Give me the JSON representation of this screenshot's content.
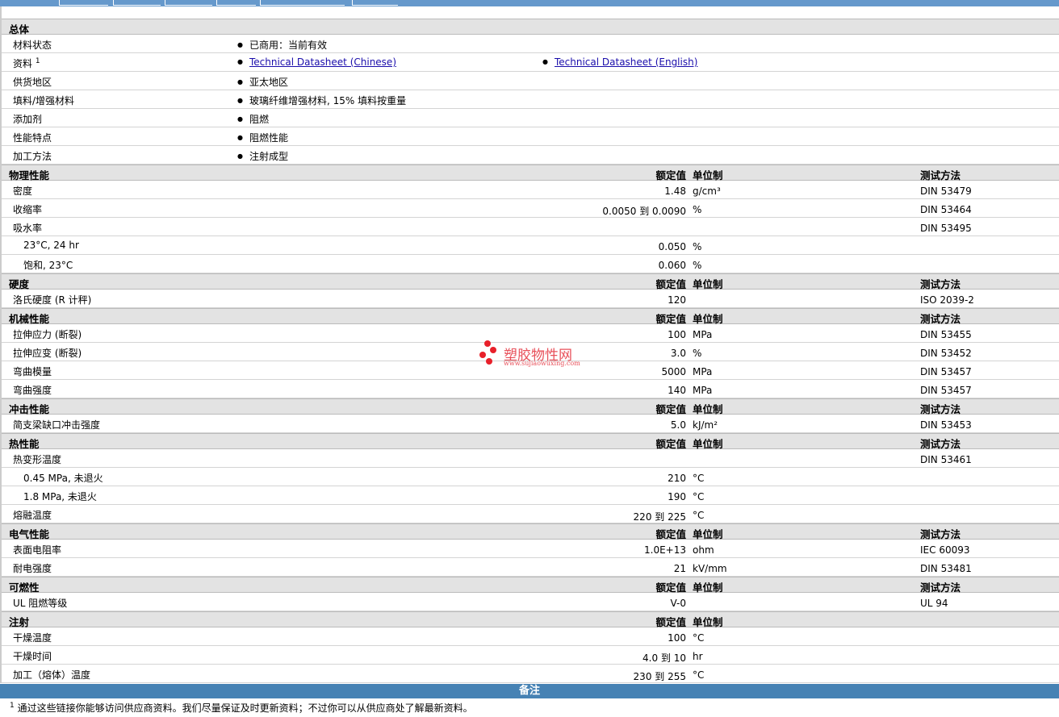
{
  "general": {
    "title": "总体",
    "rows": [
      {
        "name": "材料状态",
        "items": [
          "已商用：当前有效"
        ]
      },
      {
        "name": "资料",
        "sup": "1",
        "links": [
          "Technical Datasheet (Chinese)",
          "Technical Datasheet (English)"
        ]
      },
      {
        "name": "供货地区",
        "items": [
          "亚太地区"
        ]
      },
      {
        "name": "填料/增强材料",
        "items": [
          "玻璃纤维增强材料, 15% 填料按重量"
        ]
      },
      {
        "name": "添加剂",
        "items": [
          "阻燃"
        ]
      },
      {
        "name": "性能特点",
        "items": [
          "阻燃性能"
        ]
      },
      {
        "name": "加工方法",
        "items": [
          "注射成型"
        ]
      }
    ]
  },
  "col_headers": {
    "value": "额定值",
    "unit": "单位制",
    "test": "测试方法"
  },
  "sections": [
    {
      "title": "物理性能",
      "test_header": true,
      "rows": [
        {
          "name": "密度",
          "value": "1.48",
          "unit": "g/cm³",
          "test": "DIN 53479"
        },
        {
          "name": "收缩率",
          "value": "0.0050 到  0.0090",
          "unit": "%",
          "test": "DIN 53464"
        },
        {
          "name": "吸水率",
          "value": "",
          "unit": "",
          "test": "DIN 53495"
        },
        {
          "name": "23°C, 24 hr",
          "indent": true,
          "value": "0.050",
          "unit": "%",
          "test": ""
        },
        {
          "name": "饱和, 23°C",
          "indent": true,
          "value": "0.060",
          "unit": "%",
          "test": ""
        }
      ]
    },
    {
      "title": "硬度",
      "test_header": true,
      "rows": [
        {
          "name": "洛氏硬度 (R 计秤)",
          "value": "120",
          "unit": "",
          "test": "ISO 2039-2"
        }
      ]
    },
    {
      "title": "机械性能",
      "test_header": true,
      "rows": [
        {
          "name": "拉伸应力 (断裂)",
          "value": "100",
          "unit": "MPa",
          "test": "DIN 53455"
        },
        {
          "name": "拉伸应变 (断裂)",
          "value": "3.0",
          "unit": "%",
          "test": "DIN 53452"
        },
        {
          "name": "弯曲模量",
          "value": "5000",
          "unit": "MPa",
          "test": "DIN 53457"
        },
        {
          "name": "弯曲强度",
          "value": "140",
          "unit": "MPa",
          "test": "DIN 53457"
        }
      ]
    },
    {
      "title": "冲击性能",
      "test_header": true,
      "rows": [
        {
          "name": "简支梁缺口冲击强度",
          "value": "5.0",
          "unit": "kJ/m²",
          "test": "DIN 53453"
        }
      ]
    },
    {
      "title": "热性能",
      "test_header": true,
      "rows": [
        {
          "name": "热变形温度",
          "value": "",
          "unit": "",
          "test": "DIN 53461"
        },
        {
          "name": "0.45 MPa, 未退火",
          "indent": true,
          "value": "210",
          "unit": "°C",
          "test": ""
        },
        {
          "name": "1.8 MPa, 未退火",
          "indent": true,
          "value": "190",
          "unit": "°C",
          "test": ""
        },
        {
          "name": "熔融温度",
          "value": "220 到  225",
          "unit": "°C",
          "test": ""
        }
      ]
    },
    {
      "title": "电气性能",
      "test_header": true,
      "rows": [
        {
          "name": "表面电阻率",
          "value": "1.0E+13",
          "unit": "ohm",
          "test": "IEC 60093"
        },
        {
          "name": "耐电强度",
          "value": "21",
          "unit": "kV/mm",
          "test": "DIN 53481"
        }
      ]
    },
    {
      "title": "可燃性",
      "test_header": true,
      "rows": [
        {
          "name": "UL 阻燃等级",
          "value": "V-0",
          "unit": "",
          "test": "UL 94"
        }
      ]
    },
    {
      "title": "注射",
      "test_header": false,
      "rows": [
        {
          "name": "干燥温度",
          "value": "100",
          "unit": "°C",
          "test": ""
        },
        {
          "name": "干燥时间",
          "value": "4.0 到  10",
          "unit": "hr",
          "test": ""
        },
        {
          "name": "加工（熔体）温度",
          "value": "230 到  255",
          "unit": "°C",
          "test": ""
        }
      ]
    }
  ],
  "notes": {
    "title": "备注",
    "sup": "1",
    "text": "通过这些链接你能够访问供应商资料。我们尽量保证及时更新资料；不过你可以从供应商处了解最新资料。"
  },
  "watermark": {
    "name": "塑胶物性网",
    "url": "www.sujiaowuxing.com"
  },
  "colors": {
    "topbar": "#6699cc",
    "notes_bar": "#4682b4",
    "section_bg": "#e3e3e3",
    "watermark": "#e8202a"
  }
}
